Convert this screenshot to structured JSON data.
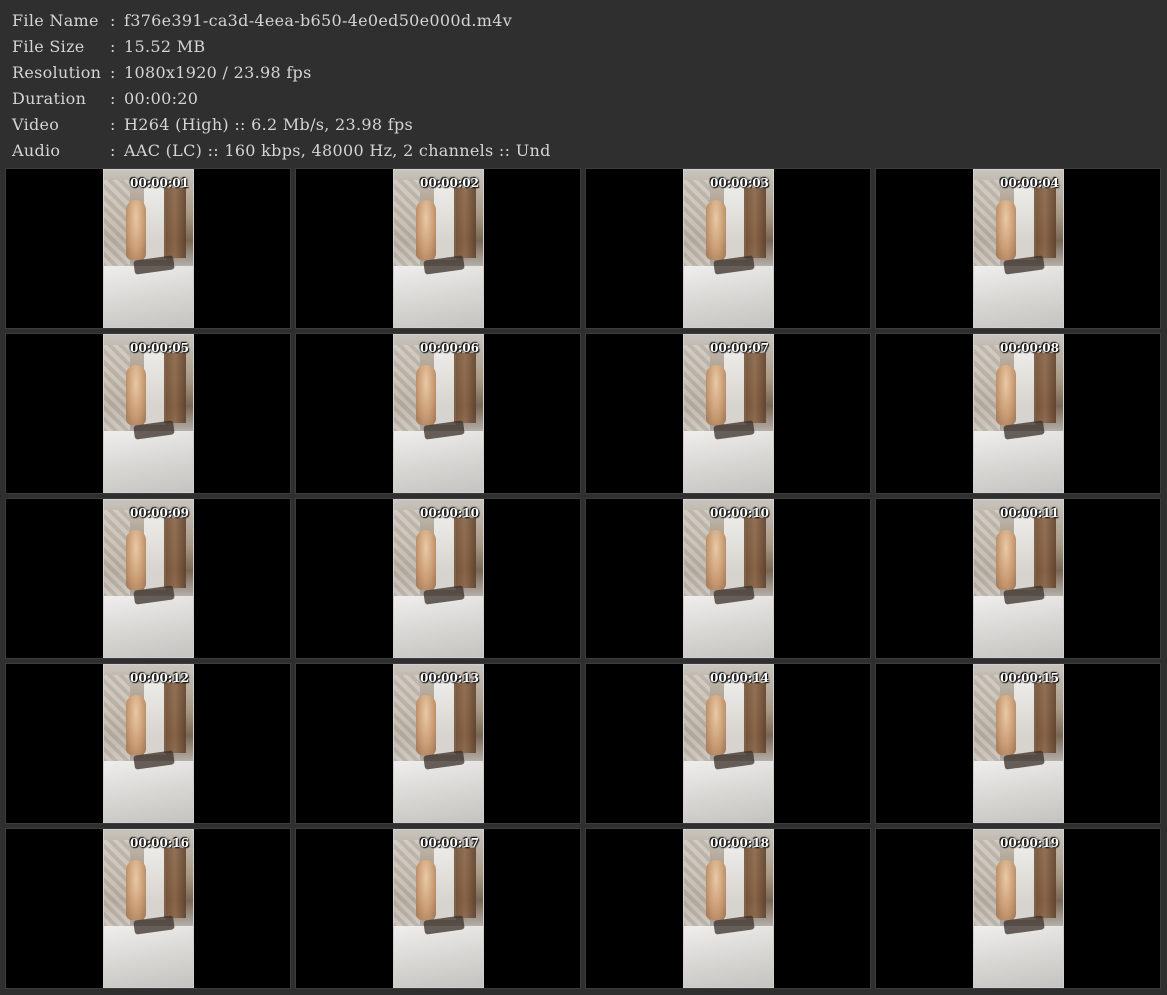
{
  "metadata": {
    "rows": [
      {
        "label": "File Name",
        "sep": ":",
        "value": "f376e391-ca3d-4eea-b650-4e0ed50e000d.m4v"
      },
      {
        "label": "File Size",
        "sep": ":",
        "value": "15.52 MB"
      },
      {
        "label": "Resolution",
        "sep": ":",
        "value": "1080x1920 / 23.98 fps"
      },
      {
        "label": "Duration",
        "sep": ":",
        "value": "00:00:20"
      },
      {
        "label": "Video",
        "sep": ":",
        "value": "H264 (High) :: 6.2 Mb/s, 23.98 fps"
      },
      {
        "label": "Audio",
        "sep": ":",
        "value": "AAC (LC) :: 160 kbps, 48000 Hz, 2 channels :: Und"
      }
    ]
  },
  "thumbnails": [
    {
      "timestamp": "00:00:01"
    },
    {
      "timestamp": "00:00:02"
    },
    {
      "timestamp": "00:00:03"
    },
    {
      "timestamp": "00:00:04"
    },
    {
      "timestamp": "00:00:05"
    },
    {
      "timestamp": "00:00:06"
    },
    {
      "timestamp": "00:00:07"
    },
    {
      "timestamp": "00:00:08"
    },
    {
      "timestamp": "00:00:09"
    },
    {
      "timestamp": "00:00:10"
    },
    {
      "timestamp": "00:00:10"
    },
    {
      "timestamp": "00:00:11"
    },
    {
      "timestamp": "00:00:12"
    },
    {
      "timestamp": "00:00:13"
    },
    {
      "timestamp": "00:00:14"
    },
    {
      "timestamp": "00:00:15"
    },
    {
      "timestamp": "00:00:16"
    },
    {
      "timestamp": "00:00:17"
    },
    {
      "timestamp": "00:00:18"
    },
    {
      "timestamp": "00:00:19"
    }
  ]
}
